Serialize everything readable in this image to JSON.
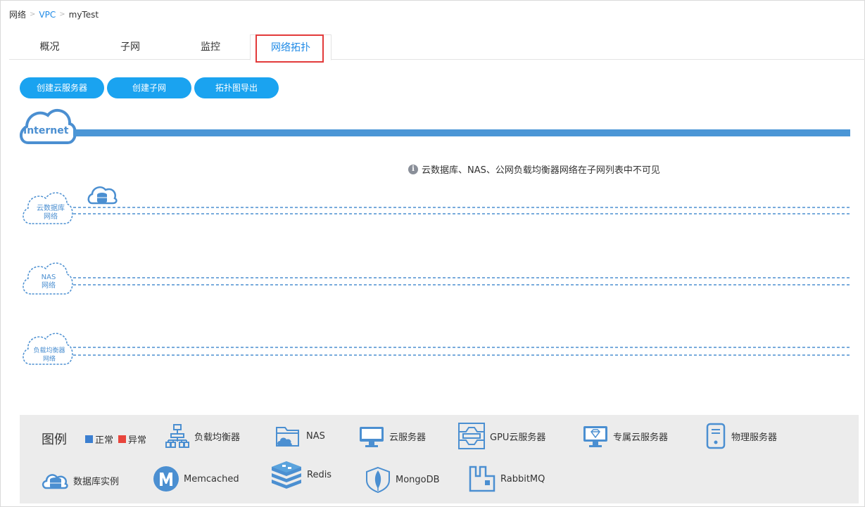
{
  "breadcrumb": {
    "items": [
      "网络",
      "VPC",
      "myTest"
    ],
    "separator": ">"
  },
  "tabs": [
    {
      "label": "概况",
      "active": false
    },
    {
      "label": "子网",
      "active": false
    },
    {
      "label": "监控",
      "active": false
    },
    {
      "label": "网络拓扑",
      "active": true
    }
  ],
  "actions": {
    "create_server": "创建云服务器",
    "create_subnet": "创建子网",
    "export_topology": "拓扑图导出"
  },
  "topology": {
    "internet_label": "Internet",
    "notice": "云数据库、NAS、公网负载均衡器网络在子网列表中不可见",
    "networks": [
      {
        "label_line1": "云数据库",
        "label_line2": "网络"
      },
      {
        "label_line1": "NAS",
        "label_line2": "网络"
      },
      {
        "label_line1": "负载均衡器",
        "label_line2": "网络"
      }
    ]
  },
  "legend": {
    "title": "图例",
    "status_normal": "正常",
    "status_abnormal": "异常",
    "colors": {
      "normal": "#3b7fd0",
      "abnormal": "#e8453c",
      "icon": "#4b8fd1",
      "accent": "#1aa3f0"
    },
    "items": [
      {
        "label": "负载均衡器",
        "icon": "load-balancer-icon"
      },
      {
        "label": "NAS",
        "icon": "nas-icon"
      },
      {
        "label": "云服务器",
        "icon": "cloud-server-icon"
      },
      {
        "label": "GPU云服务器",
        "icon": "gpu-server-icon"
      },
      {
        "label": "专属云服务器",
        "icon": "dedicated-server-icon"
      },
      {
        "label": "物理服务器",
        "icon": "physical-server-icon"
      },
      {
        "label": "数据库实例",
        "icon": "database-icon"
      },
      {
        "label": "Memcached",
        "icon": "memcached-icon"
      },
      {
        "label": "Redis",
        "icon": "redis-icon"
      },
      {
        "label": "MongoDB",
        "icon": "mongodb-icon"
      },
      {
        "label": "RabbitMQ",
        "icon": "rabbitmq-icon"
      }
    ]
  }
}
